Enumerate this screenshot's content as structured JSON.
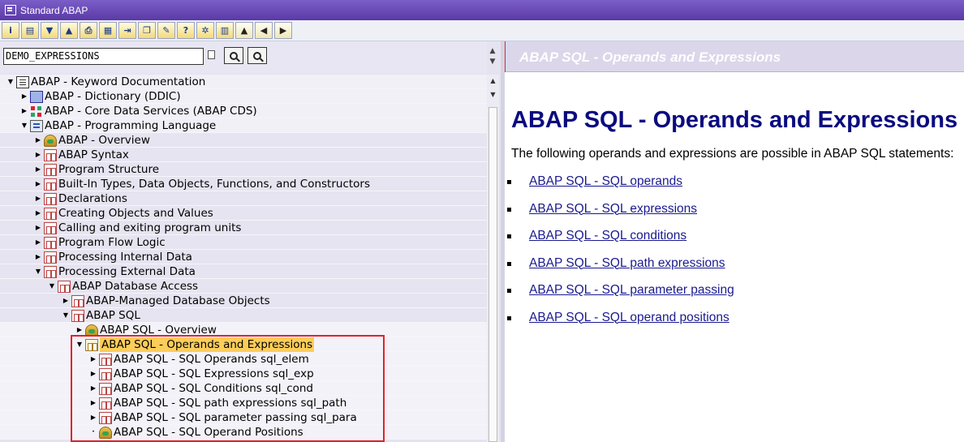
{
  "window": {
    "title": "Standard ABAP"
  },
  "toolbar": {
    "buttons": [
      "info-icon",
      "document-icon",
      "expand-icon",
      "collapse-icon",
      "print-icon",
      "page-setup-icon",
      "export-icon",
      "copy-icon",
      "bookmark-icon",
      "settings-icon",
      "gear-icon",
      "book-icon",
      "nav-up-icon",
      "nav-back-icon",
      "nav-forward-icon"
    ]
  },
  "search": {
    "value": "DEMO_EXPRESSIONS"
  },
  "tree": {
    "items": [
      {
        "label": "ABAP - Keyword Documentation",
        "level": 0,
        "state": "open",
        "icon": "book"
      },
      {
        "label": "ABAP - Dictionary (DDIC)",
        "level": 1,
        "state": "closed",
        "icon": "dict"
      },
      {
        "label": "ABAP - Core Data Services (ABAP CDS)",
        "level": 1,
        "state": "closed",
        "icon": "cds"
      },
      {
        "label": "ABAP - Programming Language",
        "level": 1,
        "state": "open",
        "icon": "prog"
      },
      {
        "label": "ABAP - Overview",
        "level": 2,
        "state": "closed",
        "icon": "over"
      },
      {
        "label": "ABAP Syntax",
        "level": 2,
        "state": "closed",
        "icon": "folder"
      },
      {
        "label": "Program Structure",
        "level": 2,
        "state": "closed",
        "icon": "folder"
      },
      {
        "label": "Built-In Types, Data Objects, Functions, and Constructors",
        "level": 2,
        "state": "closed",
        "icon": "folder"
      },
      {
        "label": "Declarations",
        "level": 2,
        "state": "closed",
        "icon": "folder"
      },
      {
        "label": "Creating Objects and Values",
        "level": 2,
        "state": "closed",
        "icon": "folder"
      },
      {
        "label": "Calling and exiting program units",
        "level": 2,
        "state": "closed",
        "icon": "folder"
      },
      {
        "label": "Program Flow Logic",
        "level": 2,
        "state": "closed",
        "icon": "folder"
      },
      {
        "label": "Processing Internal Data",
        "level": 2,
        "state": "closed",
        "icon": "folder"
      },
      {
        "label": "Processing External Data",
        "level": 2,
        "state": "open",
        "icon": "folder"
      },
      {
        "label": "ABAP Database Access",
        "level": 3,
        "state": "open",
        "icon": "folder"
      },
      {
        "label": "ABAP-Managed Database Objects",
        "level": 4,
        "state": "closed",
        "icon": "folder"
      },
      {
        "label": "ABAP SQL",
        "level": 4,
        "state": "open",
        "icon": "folder"
      },
      {
        "label": "ABAP SQL - Overview",
        "level": 5,
        "state": "closed",
        "icon": "over"
      },
      {
        "label": "ABAP SQL - Operands and Expressions",
        "level": 5,
        "state": "open",
        "icon": "folder-gold",
        "selected": true
      },
      {
        "label": "ABAP SQL - SQL Operands sql_elem",
        "level": 6,
        "state": "closed",
        "icon": "folder"
      },
      {
        "label": "ABAP SQL - SQL Expressions sql_exp",
        "level": 6,
        "state": "closed",
        "icon": "folder"
      },
      {
        "label": "ABAP SQL - SQL Conditions sql_cond",
        "level": 6,
        "state": "closed",
        "icon": "folder"
      },
      {
        "label": "ABAP SQL - SQL path expressions sql_path",
        "level": 6,
        "state": "closed",
        "icon": "folder"
      },
      {
        "label": "ABAP SQL - SQL parameter passing sql_para",
        "level": 6,
        "state": "closed",
        "icon": "folder"
      },
      {
        "label": "ABAP SQL - SQL Operand Positions",
        "level": 6,
        "state": "leaf",
        "icon": "over"
      }
    ]
  },
  "content": {
    "header": "ABAP SQL - Operands and Expressions",
    "heading": "ABAP SQL - Operands and Expressions",
    "intro": "The following operands and expressions are possible in ABAP SQL statements:",
    "links": [
      "ABAP SQL - SQL operands",
      "ABAP SQL - SQL expressions",
      "ABAP SQL - SQL conditions",
      "ABAP SQL - SQL path expressions",
      "ABAP SQL - SQL parameter passing",
      "ABAP SQL - SQL operand positions"
    ]
  }
}
